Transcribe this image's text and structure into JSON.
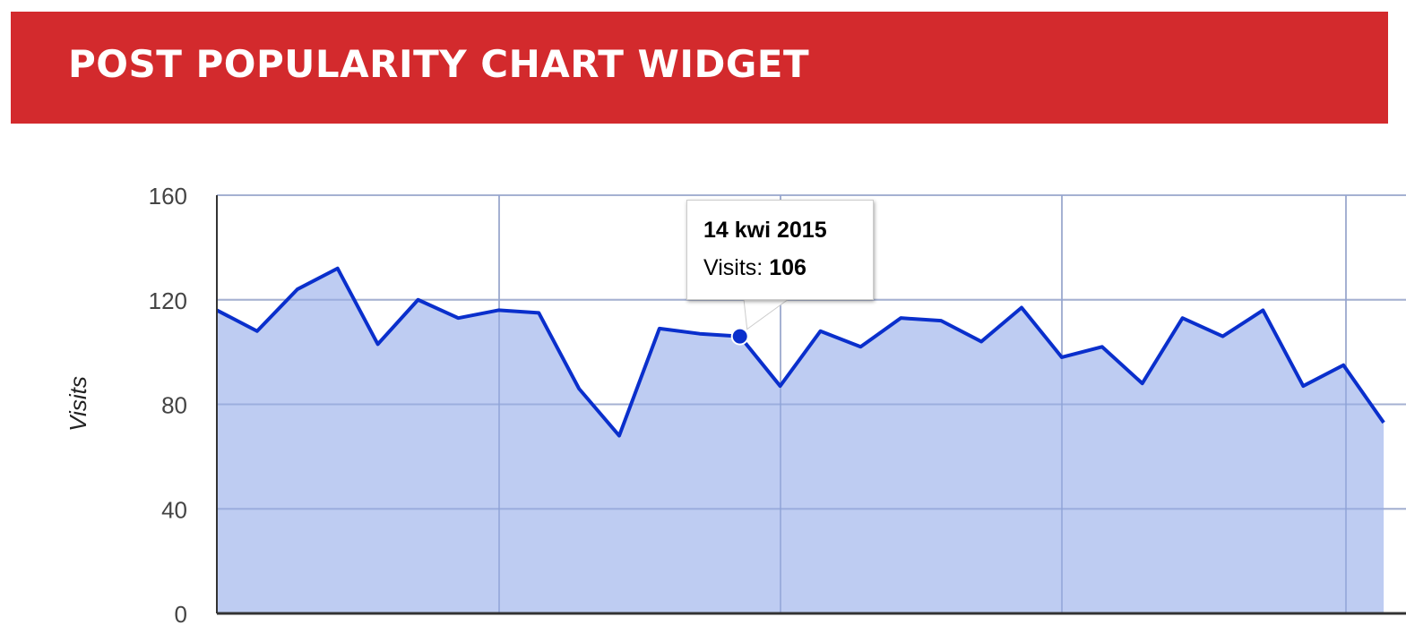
{
  "header": {
    "title": "POST POPULARITY CHART WIDGET"
  },
  "colors": {
    "header_bg": "#d32a2d",
    "line": "#0a2fcc",
    "area_fill": "#b3c3f0",
    "grid": "#cccccc",
    "axis": "#333333"
  },
  "chart_data": {
    "type": "area",
    "title": "",
    "xlabel": "",
    "ylabel": "Visits",
    "ylim": [
      0,
      160
    ],
    "yticks": [
      0,
      40,
      80,
      120,
      160
    ],
    "grid": true,
    "x_partially_clipped": true,
    "series": [
      {
        "name": "Visits",
        "values": [
          116,
          108,
          124,
          132,
          103,
          120,
          113,
          116,
          115,
          86,
          68,
          109,
          107,
          106,
          87,
          108,
          102,
          113,
          112,
          104,
          117,
          98,
          102,
          88,
          113,
          106,
          116,
          87,
          95,
          73
        ]
      }
    ],
    "highlighted_point": {
      "index": 13,
      "date": "14 kwi 2015",
      "value": 106
    }
  },
  "tooltip": {
    "date": "14 kwi 2015",
    "label": "Visits:",
    "value": "106"
  }
}
